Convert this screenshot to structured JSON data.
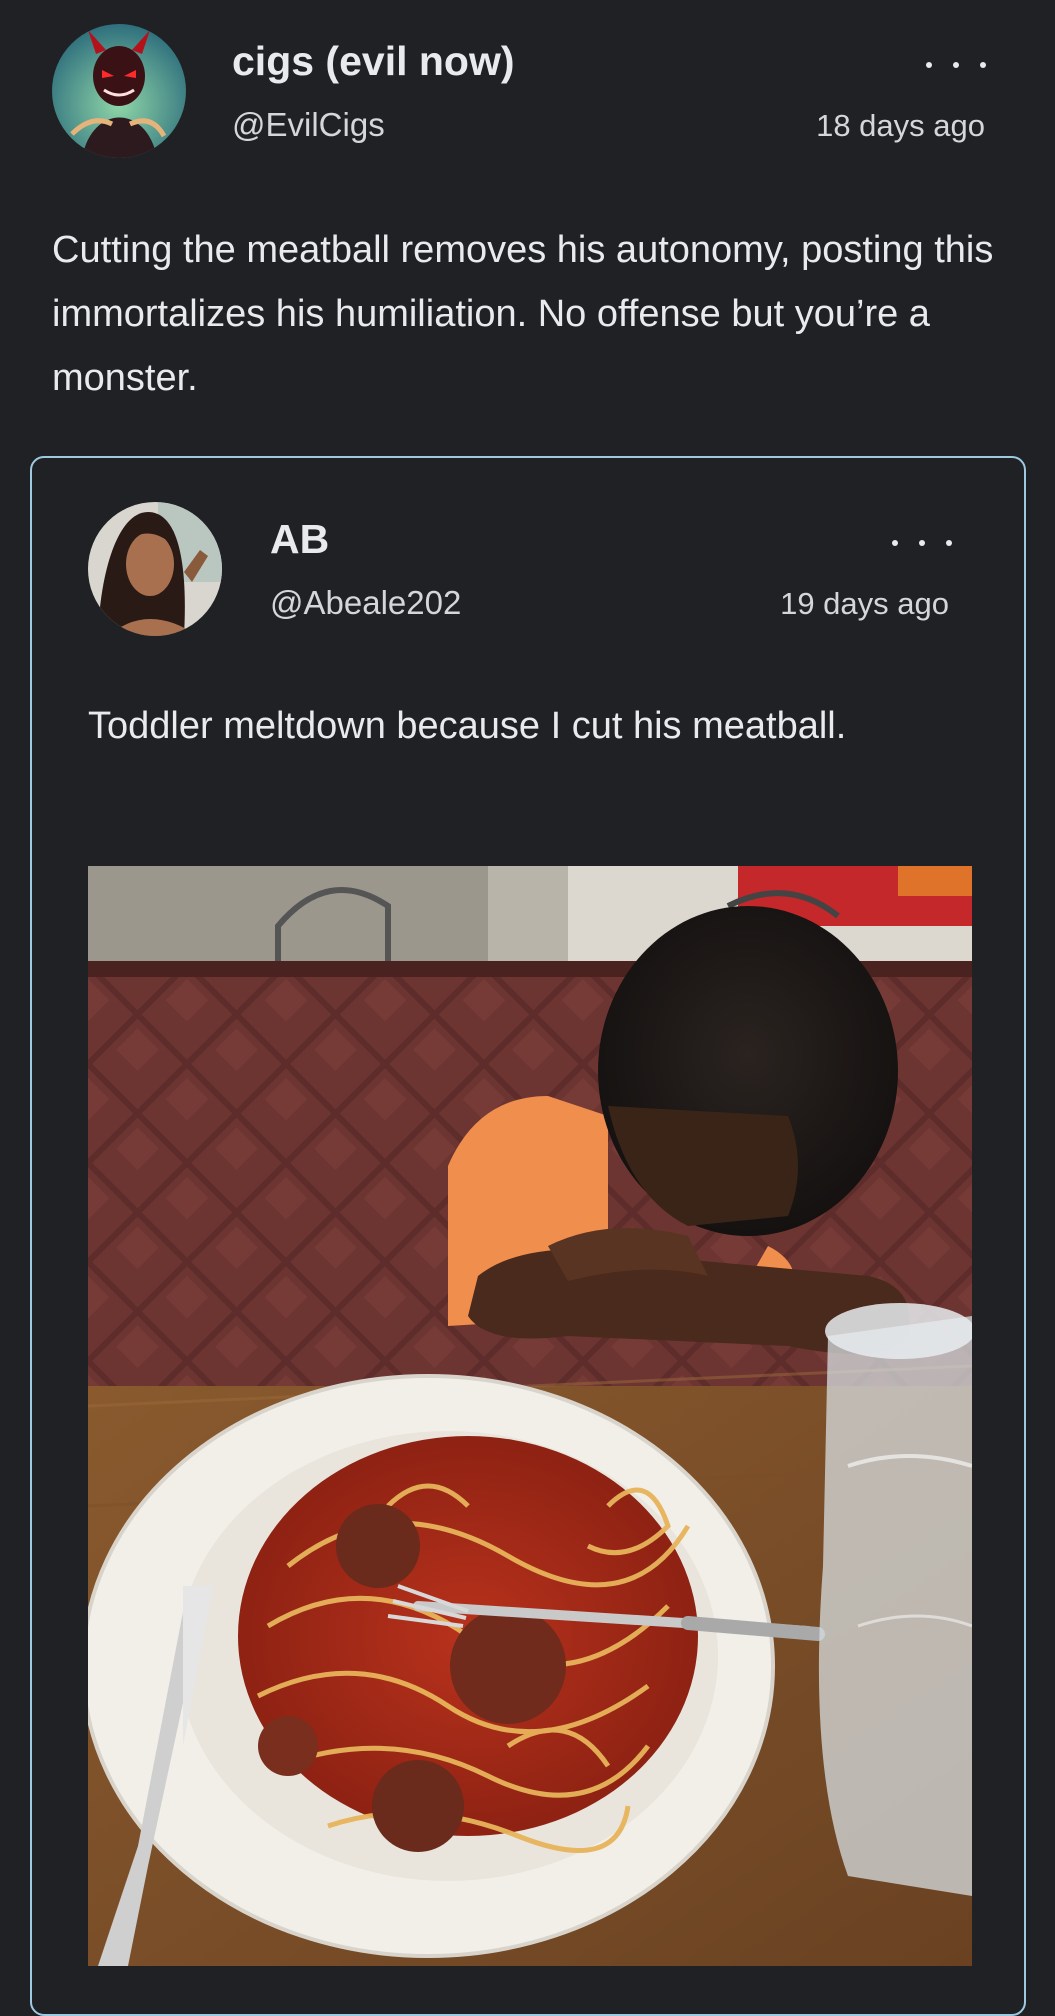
{
  "main_post": {
    "author_name": "cigs (evil now)",
    "author_handle": "@EvilCigs",
    "timestamp": "18 days ago",
    "text": "Cutting the meatball removes his autonomy, posting this immortalizes his humiliation. No offense but you’re a monster.",
    "avatar_icon": "devil-avatar-icon"
  },
  "quoted_post": {
    "author_name": "AB",
    "author_handle": "@Abeale202",
    "timestamp": "19 days ago",
    "text": "Toddler meltdown because I cut his meatball.",
    "avatar_icon": "profile-photo-avatar",
    "image": "toddler-with-spaghetti-photo"
  },
  "colors": {
    "background": "#1f2124",
    "text": "#e8eaed",
    "quote_border": "#9ec9e0"
  }
}
